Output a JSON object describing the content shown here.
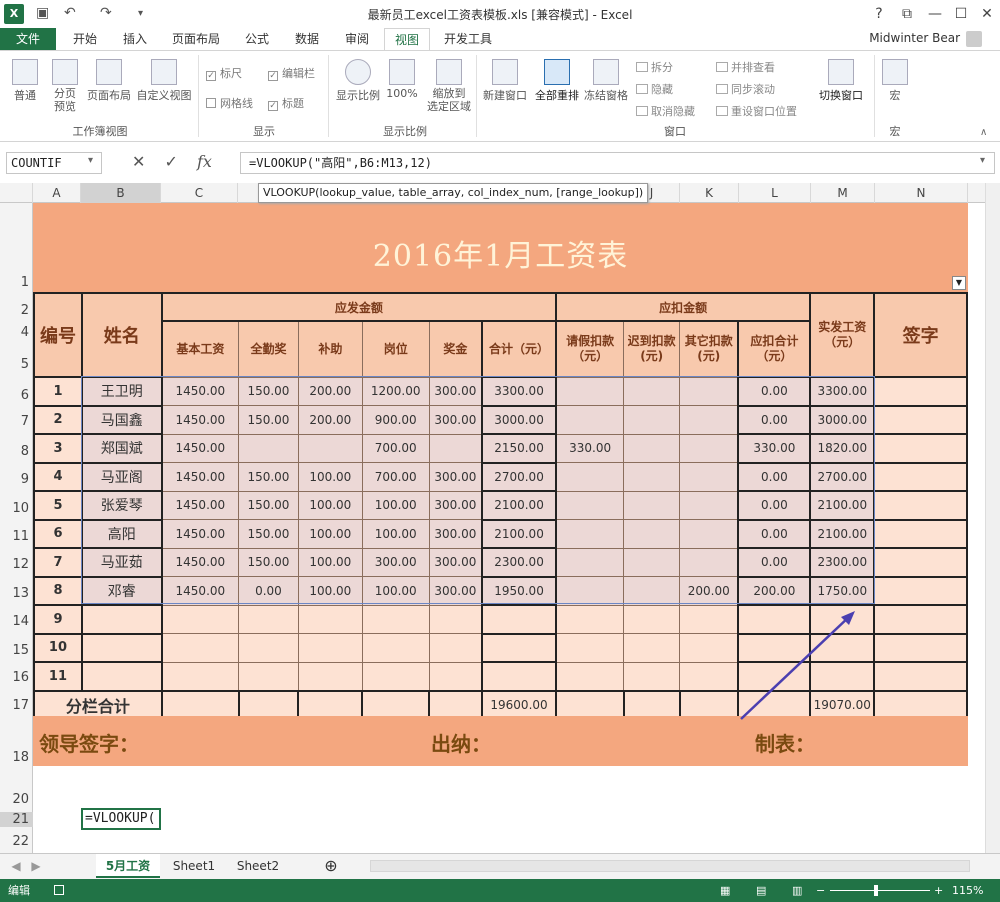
{
  "window": {
    "title": "最新员工excel工资表模板.xls  [兼容模式] - Excel",
    "user": "Midwinter Bear",
    "help": "?"
  },
  "ribbon_tabs": [
    "文件",
    "开始",
    "插入",
    "页面布局",
    "公式",
    "数据",
    "审阅",
    "视图",
    "开发工具"
  ],
  "ribbon": {
    "workbook_views": {
      "label": "工作簿视图",
      "buttons": [
        "普通",
        "分页\n预览",
        "页面布局",
        "自定义视图"
      ]
    },
    "show": {
      "label": "显示",
      "items": [
        {
          "text": "标尺",
          "checked": true
        },
        {
          "text": "编辑栏",
          "checked": true
        },
        {
          "text": "网格线",
          "checked": false
        },
        {
          "text": "标题",
          "checked": true
        }
      ]
    },
    "zoom": {
      "label": "显示比例",
      "buttons": [
        "显示比例",
        "100%",
        "缩放到\n选定区域"
      ]
    },
    "window": {
      "label": "窗口",
      "buttons": [
        "新建窗口",
        "全部重排",
        "冻结窗格"
      ],
      "small": [
        "拆分",
        "隐藏",
        "取消隐藏",
        "并排查看",
        "同步滚动",
        "重设窗口位置"
      ],
      "switch": "切换窗口"
    },
    "macro": {
      "label": "宏",
      "button": "宏"
    }
  },
  "formula_bar": {
    "name_box": "COUNTIF",
    "formula": "=VLOOKUP(\"高阳\",B6:M13,12)",
    "tooltip": "VLOOKUP(lookup_value, table_array, col_index_num, [range_lookup])"
  },
  "columns": [
    "A",
    "B",
    "C",
    "D",
    "E",
    "F",
    "G",
    "H",
    "I",
    "J",
    "K",
    "L",
    "M",
    "N"
  ],
  "rows": [
    "1",
    "2",
    "4",
    "5",
    "6",
    "7",
    "8",
    "9",
    "10",
    "11",
    "12",
    "13",
    "14",
    "15",
    "16",
    "17",
    "18",
    "20",
    "21",
    "22"
  ],
  "sheet": {
    "title": "2016年1月工资表",
    "headers": {
      "id": "编号",
      "name": "姓名",
      "income_group": "应发金额",
      "deduct_group": "应扣金额",
      "net": "实发工资（元）",
      "sign": "签字",
      "income": [
        "基本工资",
        "全勤奖",
        "补助",
        "岗位",
        "奖金",
        "合计（元）"
      ],
      "deduct": [
        "请假扣款（元）",
        "迟到扣款(元)",
        "其它扣款(元)",
        "应扣合计（元）"
      ]
    },
    "rows": [
      [
        "1",
        "王卫明",
        "1450.00",
        "150.00",
        "200.00",
        "1200.00",
        "300.00",
        "3300.00",
        "",
        "",
        "",
        "0.00",
        "3300.00",
        ""
      ],
      [
        "2",
        "马国鑫",
        "1450.00",
        "150.00",
        "200.00",
        "900.00",
        "300.00",
        "3000.00",
        "",
        "",
        "",
        "0.00",
        "3000.00",
        ""
      ],
      [
        "3",
        "郑国斌",
        "1450.00",
        "",
        "",
        "700.00",
        "",
        "2150.00",
        "330.00",
        "",
        "",
        "330.00",
        "1820.00",
        ""
      ],
      [
        "4",
        "马亚阁",
        "1450.00",
        "150.00",
        "100.00",
        "700.00",
        "300.00",
        "2700.00",
        "",
        "",
        "",
        "0.00",
        "2700.00",
        ""
      ],
      [
        "5",
        "张爱琴",
        "1450.00",
        "150.00",
        "100.00",
        "100.00",
        "300.00",
        "2100.00",
        "",
        "",
        "",
        "0.00",
        "2100.00",
        ""
      ],
      [
        "6",
        "高阳",
        "1450.00",
        "150.00",
        "100.00",
        "100.00",
        "300.00",
        "2100.00",
        "",
        "",
        "",
        "0.00",
        "2100.00",
        ""
      ],
      [
        "7",
        "马亚茹",
        "1450.00",
        "150.00",
        "100.00",
        "300.00",
        "300.00",
        "2300.00",
        "",
        "",
        "",
        "0.00",
        "2300.00",
        ""
      ],
      [
        "8",
        "邓睿",
        "1450.00",
        "0.00",
        "100.00",
        "100.00",
        "300.00",
        "1950.00",
        "",
        "",
        "200.00",
        "200.00",
        "1750.00",
        ""
      ],
      [
        "9",
        "",
        "",
        "",
        "",
        "",
        "",
        "",
        "",
        "",
        "",
        "",
        "",
        ""
      ],
      [
        "10",
        "",
        "",
        "",
        "",
        "",
        "",
        "",
        "",
        "",
        "",
        "",
        "",
        ""
      ],
      [
        "11",
        "",
        "",
        "",
        "",
        "",
        "",
        "",
        "",
        "",
        "",
        "",
        "",
        ""
      ]
    ],
    "subtotal": {
      "label": "分栏合计",
      "total": "19600.00",
      "net": "19070.00"
    },
    "sign_row": {
      "leader": "领导签字：",
      "cashier": "出纳：",
      "maker": "制表："
    },
    "editing_cell": "=VLOOKUP("
  },
  "sheet_tabs": [
    "5月工资",
    "Sheet1",
    "Sheet2"
  ],
  "status": {
    "mode": "编辑",
    "zoom": "115%"
  },
  "colors": {
    "accent": "#217346",
    "banner": "#f4a77f"
  }
}
